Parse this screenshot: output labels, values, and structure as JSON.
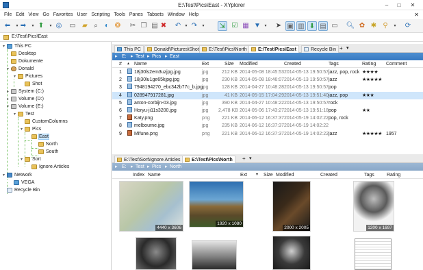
{
  "window": {
    "title": "E:\\Test\\Pics\\East - XYplorer"
  },
  "menu": [
    "File",
    "Edit",
    "View",
    "Go",
    "Favorites",
    "User",
    "Scripting",
    "Tools",
    "Panes",
    "Tabsets",
    "Window",
    "Help"
  ],
  "address": "E:\\Test\\Pics\\East",
  "tree": {
    "items": [
      {
        "label": "This PC",
        "type": "pc"
      },
      {
        "label": "Desktop",
        "type": "fold"
      },
      {
        "label": "Dokumente",
        "type": "fold"
      },
      {
        "label": "Donald",
        "type": "usr"
      },
      {
        "label": "Pictures",
        "type": "fold"
      },
      {
        "label": "Shot",
        "type": "fold"
      },
      {
        "label": "System (C:)",
        "type": "drv"
      },
      {
        "label": "Volume (D:)",
        "type": "drv"
      },
      {
        "label": "Volume (E:)",
        "type": "drv"
      },
      {
        "label": "Test",
        "type": "fold"
      },
      {
        "label": "CustomColumns",
        "type": "fold"
      },
      {
        "label": "Pics",
        "type": "fold"
      },
      {
        "label": "East",
        "type": "fold"
      },
      {
        "label": "North",
        "type": "fold"
      },
      {
        "label": "South",
        "type": "fold"
      },
      {
        "label": "Sort",
        "type": "fold"
      },
      {
        "label": "Ignore Articles",
        "type": "fold"
      },
      {
        "label": "Network",
        "type": "net"
      },
      {
        "label": "VEGA",
        "type": "pc"
      },
      {
        "label": "Recycle Bin",
        "type": "bin"
      }
    ]
  },
  "pane1": {
    "tabs": [
      "This PC",
      "Donald\\Pictures\\Shot",
      "E:\\Test\\Pics\\North",
      "E:\\Test\\Pics\\East",
      "Recycle Bin"
    ],
    "add_tab": "+",
    "tab_menu": "▾",
    "crumb": [
      "E:",
      "Test",
      "Pics",
      "East"
    ],
    "columns": [
      "#",
      "Name",
      "Ext",
      "Size",
      "Modified",
      "Created",
      "Tags",
      "Rating",
      "Comment"
    ],
    "rows": [
      {
        "n": "1",
        "name": "18j30ls2em3uzjpg.jpg",
        "ext": "jpg",
        "size": "212 KB",
        "mod": "2014-05-08 18:45:53",
        "cre": "2014-05-13 19:50:57",
        "tags": "jazz, pop, rock",
        "rating": "★★★★",
        "comment": "",
        "icon": "img"
      },
      {
        "n": "2",
        "name": "18j30lu1ge65kjpg.jpg",
        "ext": "jpg",
        "size": "230 KB",
        "mod": "2014-05-08 18:46:07",
        "cre": "2014-05-13 19:50:57",
        "tags": "jazz",
        "rating": "★★★★★",
        "comment": "",
        "icon": "img"
      },
      {
        "n": "3",
        "name": "7948194270_ebc342b77c_b.jpg",
        "ext": "jpg",
        "size": "128 KB",
        "mod": "2014-04-27 10:48:28",
        "cre": "2014-05-13 19:50:57",
        "tags": "pop",
        "rating": "",
        "comment": "",
        "icon": "img"
      },
      {
        "n": "4",
        "name": "028947917281.jpg",
        "ext": "jpg",
        "size": "41 KB",
        "mod": "2014-05-15 17:04:29",
        "cre": "2014-05-13 19:51:40",
        "tags": "jazz, pop",
        "rating": "★★★",
        "comment": "",
        "icon": "img"
      },
      {
        "n": "5",
        "name": "anton-corbijn-03.jpg",
        "ext": "jpg",
        "size": "390 KB",
        "mod": "2014-04-27 10:48:22",
        "cre": "2014-05-13 19:50:57",
        "tags": "rock",
        "rating": "",
        "comment": "",
        "icon": "img"
      },
      {
        "n": "6",
        "name": "Horyu-ji11s3200.jpg",
        "ext": "jpg",
        "size": "2,478 KB",
        "mod": "2014-05-06 17:43:27",
        "cre": "2014-05-13 19:51:18",
        "tags": "pop",
        "rating": "★★",
        "comment": "",
        "icon": "img"
      },
      {
        "n": "7",
        "name": "Katy.png",
        "ext": "png",
        "size": "221 KB",
        "mod": "2014-06-12 16:37:37",
        "cre": "2014-05-19 14:02:22",
        "tags": "pop, rock",
        "rating": "",
        "comment": "",
        "icon": "sc"
      },
      {
        "n": "8",
        "name": "melbourne.jpg",
        "ext": "jpg",
        "size": "235 KB",
        "mod": "2014-06-12 16:37:37",
        "cre": "2014-05-19 14:02:22",
        "tags": "",
        "rating": "",
        "comment": "",
        "icon": "img"
      },
      {
        "n": "9",
        "name": "Mifune.png",
        "ext": "png",
        "size": "221 KB",
        "mod": "2014-06-12 16:37:37",
        "cre": "2014-05-19 14:02:22",
        "tags": "jazz",
        "rating": "★★★★★",
        "comment": "1957",
        "icon": "sc"
      }
    ]
  },
  "pane2": {
    "tabs": [
      "E:\\Test\\Sort\\Ignore Articles",
      "E:\\Test\\Pics\\North"
    ],
    "add_tab": "+",
    "tab_menu": "▾",
    "crumb": [
      "E:",
      "Test",
      "Pics",
      "North"
    ],
    "columns": [
      "Index",
      "Name",
      "Ext",
      "Size",
      "Modified",
      "Created",
      "Tags",
      "Rating"
    ],
    "thumbs": [
      {
        "label": "4440 x 3606",
        "kind": "map"
      },
      {
        "label": "1920 x 1080",
        "kind": "babel"
      },
      {
        "label": "2000 x 2005",
        "kind": "ambassadors"
      },
      {
        "label": "1200 x 1697",
        "kind": "portrait"
      },
      {
        "label": "",
        "kind": "man"
      },
      {
        "label": "",
        "kind": "group"
      },
      {
        "label": "",
        "kind": "woman"
      },
      {
        "label": "",
        "kind": "doc"
      }
    ]
  }
}
